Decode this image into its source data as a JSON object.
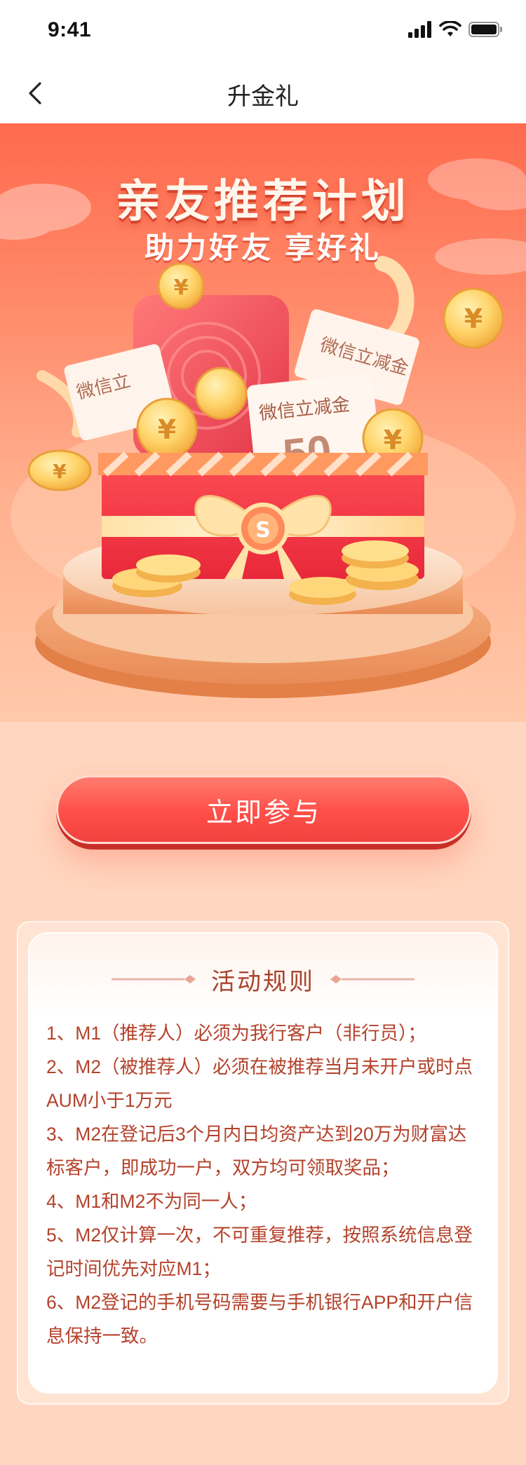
{
  "status_bar": {
    "time": "9:41"
  },
  "nav": {
    "title": "升金礼"
  },
  "hero": {
    "title": "亲友推荐计划",
    "subtitle": "助力好友 享好礼",
    "ticket_label": "微信立减金",
    "ticket_label_short": "微信立",
    "ticket_amount": "50",
    "currency_symbol": "¥"
  },
  "cta": {
    "label": "立即参与"
  },
  "rules": {
    "title": "活动规则",
    "items": [
      "1、M1（推荐人）必须为我行客户（非行员）；",
      "2、M2（被推荐人）必须在被推荐当月未开户或时点AUM小于1万元",
      "3、M2在登记后3个月内日均资产达到20万为财富达标客户，即成功一户，双方均可领取奖品；",
      "4、M1和M2不为同一人；",
      "5、M2仅计算一次，不可重复推荐，按照系统信息登记时间优先对应M1；",
      "6、M2登记的手机号码需要与手机银行APP和开户信息保持一致。"
    ]
  },
  "colors": {
    "accent": "#ff4e48",
    "rule_text": "#b4422b",
    "page_bg": "#ffd6bf"
  }
}
